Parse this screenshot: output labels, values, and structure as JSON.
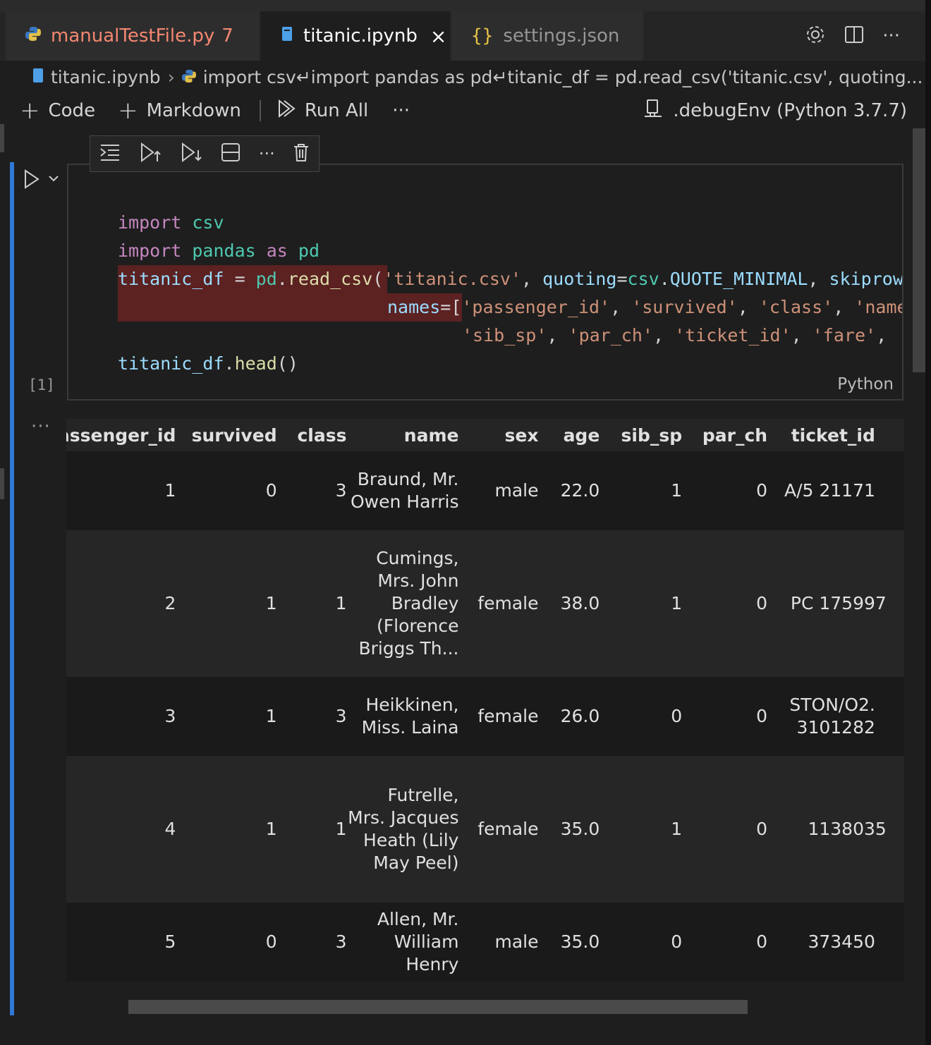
{
  "tabs": [
    {
      "label": "manualTestFile.py",
      "badge": "7",
      "icon": "python-icon"
    },
    {
      "label": "titanic.ipynb",
      "icon": "notebook-icon",
      "active": true
    },
    {
      "label": "settings.json",
      "icon": "braces-icon"
    }
  ],
  "breadcrumb": {
    "file": "titanic.ipynb",
    "cell": "import csv↵import pandas as pd↵titanic_df = pd.read_csv('titanic.csv', quoting..."
  },
  "toolbar": {
    "code_label": "Code",
    "markdown_label": "Markdown",
    "run_all_label": "Run All",
    "more": "···",
    "kernel": ".debugEnv (Python 3.7.7)"
  },
  "cell": {
    "language": "Python",
    "exec_count": "[1]",
    "output_more": "···"
  },
  "code_tokens": {
    "l1_kw": "import",
    "l1_mod": "csv",
    "l2_kw": "import",
    "l2_mod": "pandas",
    "l2_as": "as",
    "l2_alias": "pd",
    "l3_var": "titanic_df",
    "l3_eq": " = ",
    "l3_pd": "pd",
    "l3_dot": ".",
    "l3_fn": "read_csv",
    "l3_open": "(",
    "l3_str": "'titanic.csv'",
    "l3_comma": ", ",
    "l3_kwarg": "quoting",
    "l3_eq2": "=",
    "l3_csv": "csv",
    "l3_dot2": ".",
    "l3_const": "QUOTE_MINIMAL",
    "l3_comma2": ", ",
    "l3_kwarg2": "skiprows",
    "l4_kwarg": "names",
    "l4_eq": "=[",
    "l4_s1": "'passenger_id'",
    "l4_c1": ", ",
    "l4_s2": "'survived'",
    "l4_c2": ", ",
    "l4_s3": "'class'",
    "l4_c3": ", ",
    "l4_s4": "'name'",
    "l5_s1": "'sib_sp'",
    "l5_c1": ", ",
    "l5_s2": "'par_ch'",
    "l5_c2": ", ",
    "l5_s3": "'ticket_id'",
    "l5_c3": ", ",
    "l5_s4": "'fare'",
    "l5_c4": ",",
    "l6_var": "titanic_df",
    "l6_dot": ".",
    "l6_fn": "head",
    "l6_paren": "()"
  },
  "table": {
    "headers": [
      "passenger_id",
      "survived",
      "class",
      "name",
      "sex",
      "age",
      "sib_sp",
      "par_ch",
      "ticket_id"
    ],
    "rows": [
      {
        "passenger_id": "1",
        "survived": "0",
        "class": "3",
        "name": "Braund, Mr. Owen Harris",
        "sex": "male",
        "age": "22.0",
        "sib_sp": "1",
        "par_ch": "0",
        "ticket_id": "A/5 21171",
        "next": ""
      },
      {
        "passenger_id": "2",
        "survived": "1",
        "class": "1",
        "name": "Cumings, Mrs. John Bradley (Florence Briggs Th...",
        "sex": "female",
        "age": "38.0",
        "sib_sp": "1",
        "par_ch": "0",
        "ticket_id": "PC 17599",
        "next": "7"
      },
      {
        "passenger_id": "3",
        "survived": "1",
        "class": "3",
        "name": "Heikkinen, Miss. Laina",
        "sex": "female",
        "age": "26.0",
        "sib_sp": "0",
        "par_ch": "0",
        "ticket_id": "STON/O2. 3101282",
        "next": ""
      },
      {
        "passenger_id": "4",
        "survived": "1",
        "class": "1",
        "name": "Futrelle, Mrs. Jacques Heath (Lily May Peel)",
        "sex": "female",
        "age": "35.0",
        "sib_sp": "1",
        "par_ch": "0",
        "ticket_id": "113803",
        "next": "5"
      },
      {
        "passenger_id": "5",
        "survived": "0",
        "class": "3",
        "name": "Allen, Mr. William Henry",
        "sex": "male",
        "age": "35.0",
        "sib_sp": "0",
        "par_ch": "0",
        "ticket_id": "373450",
        "next": ""
      }
    ]
  },
  "colors": {
    "accent": "#2f78d6",
    "error_band": "#5c2121",
    "tab_warning": "#f48771"
  }
}
